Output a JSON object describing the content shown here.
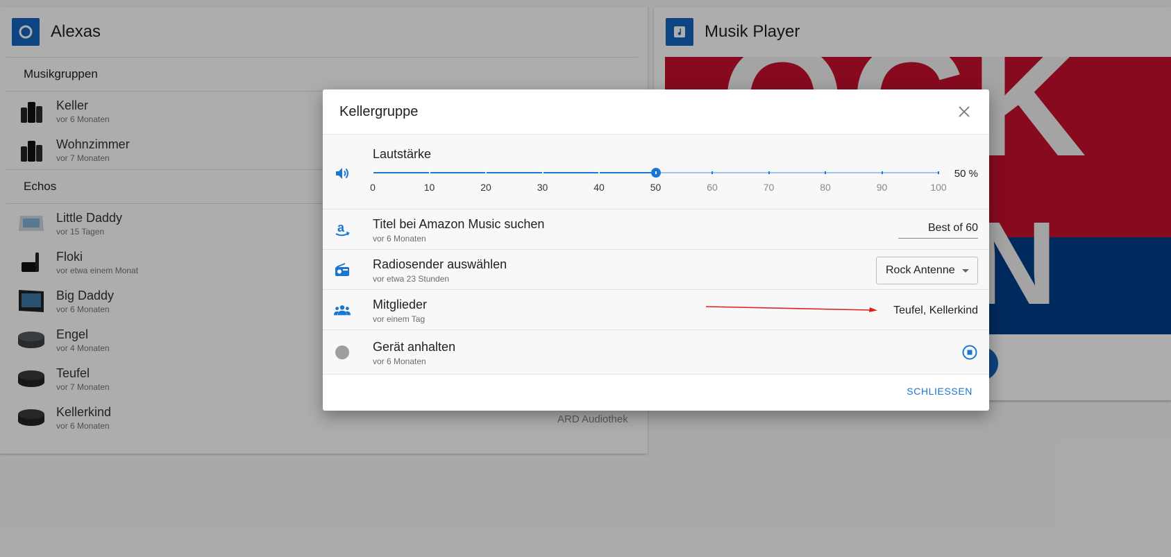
{
  "alexas_card": {
    "title": "Alexas",
    "icon": "alexa-ring-icon",
    "sections": [
      {
        "label": "Musikgruppen",
        "devices": [
          {
            "name": "Keller",
            "sub": "vor 6 Monaten",
            "icon": "speaker-group-icon"
          },
          {
            "name": "Wohnzimmer",
            "sub": "vor 7 Monaten",
            "icon": "speaker-group-icon"
          }
        ]
      },
      {
        "label": "Echos",
        "devices": [
          {
            "name": "Little Daddy",
            "sub": "vor 15 Tagen",
            "icon": "echo-show-small-icon"
          },
          {
            "name": "Floki",
            "sub": "vor etwa einem Monat",
            "icon": "fire-tv-icon"
          },
          {
            "name": "Big Daddy",
            "sub": "vor 6 Monaten",
            "icon": "echo-show-icon"
          },
          {
            "name": "Engel",
            "sub": "vor 4 Monaten",
            "icon": "echo-dot-icon"
          },
          {
            "name": "Teufel",
            "sub": "vor 7 Monaten",
            "icon": "echo-dot-icon"
          },
          {
            "name": "Kellerkind",
            "sub": "vor 6 Monaten",
            "icon": "echo-dot-icon"
          }
        ]
      }
    ],
    "footer_text": "ARD Audiothek"
  },
  "player_card": {
    "title": "Musik Player",
    "icon": "music-note-icon",
    "cover_text_top": "OCK",
    "cover_text_bottom": "ENN"
  },
  "dialog": {
    "title": "Kellergruppe",
    "close_icon": "close-icon",
    "volume": {
      "label": "Lautstärke",
      "icon": "volume-up-icon",
      "value": 50,
      "value_text": "50 %",
      "ticks": [
        "0",
        "10",
        "20",
        "30",
        "40",
        "50",
        "60",
        "70",
        "80",
        "90",
        "100"
      ]
    },
    "amazon_search": {
      "label": "Titel bei Amazon Music suchen",
      "sub": "vor 6 Monaten",
      "icon": "amazon-icon",
      "value": "Best of 60"
    },
    "radio": {
      "label": "Radiosender auswählen",
      "sub": "vor etwa 23 Stunden",
      "icon": "radio-icon",
      "selected": "Rock Antenne"
    },
    "members": {
      "label": "Mitglieder",
      "sub": "vor einem Tag",
      "icon": "group-icon",
      "value": "Teufel, Kellerkind"
    },
    "stop": {
      "label": "Gerät anhalten",
      "sub": "vor 6 Monaten",
      "icon": "device-status-dot-icon",
      "button_icon": "stop-circle-icon"
    },
    "footer_button": "SCHLIESSEN"
  },
  "colors": {
    "accent": "#1976d2",
    "annotation_arrow": "#e02020"
  }
}
